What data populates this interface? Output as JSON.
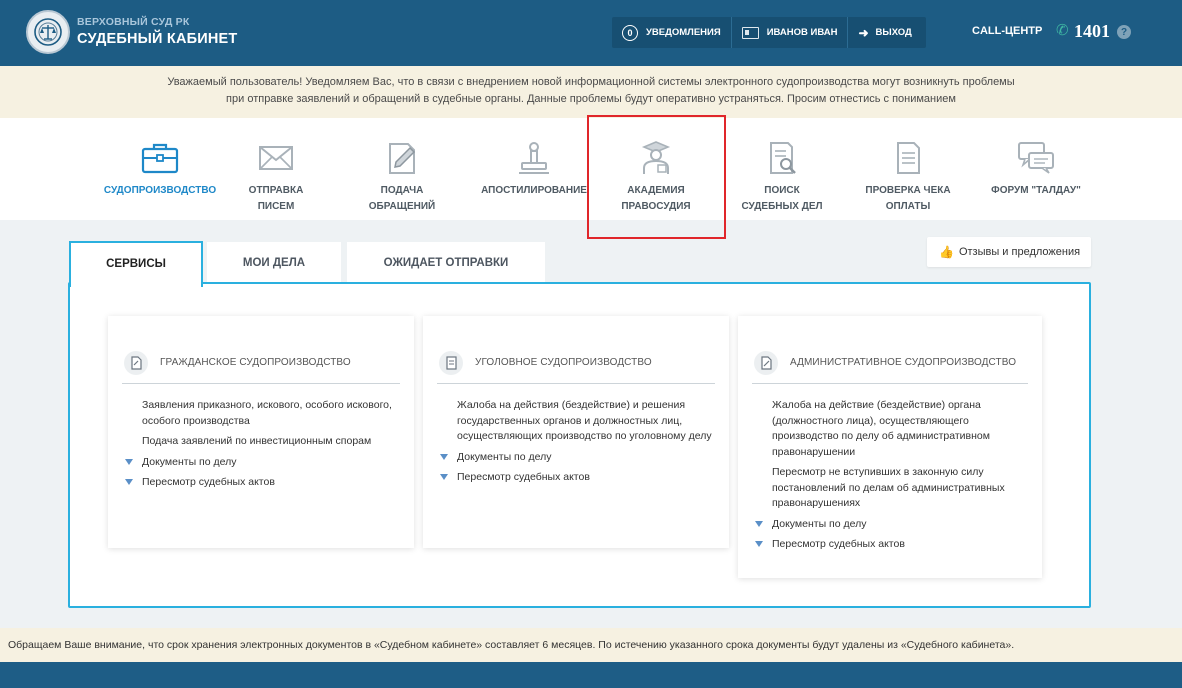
{
  "header": {
    "logo_small": "ВЕРХОВНЫЙ СУД РК",
    "logo_big": "СУДЕБНЫЙ КАБИНЕТ",
    "notifications_count": "0",
    "notifications_label": "УВЕДОМЛЕНИЯ",
    "user_name": "ИВАНОВ ИВАН",
    "logout_label": "ВЫХОД",
    "callcenter_label": "CALL-ЦЕНТР",
    "callcenter_number": "1401",
    "help_glyph": "?"
  },
  "notice": {
    "line1": "Уважаемый пользователь! Уведомляем Вас, что в связи с внедрением новой информационной системы электронного судопроизводства могут возникнуть проблемы",
    "line2": "при отправке заявлений и обращений в судебные органы. Данные проблемы будут оперативно устраняться. Просим отнестись с пониманием"
  },
  "nav": {
    "items": [
      {
        "line1": "СУДОПРОИЗВОДСТВО",
        "line2": "",
        "icon": "briefcase-icon",
        "active": true
      },
      {
        "line1": "ОТПРАВКА",
        "line2": "ПИСЕМ",
        "icon": "envelope-icon"
      },
      {
        "line1": "ПОДАЧА",
        "line2": "ОБРАЩЕНИЙ",
        "icon": "document-pen-icon"
      },
      {
        "line1": "АПОСТИЛИРОВАНИЕ",
        "line2": "",
        "icon": "stamp-icon"
      },
      {
        "line1": "АКАДЕМИЯ",
        "line2": "ПРАВОСУДИЯ",
        "icon": "graduate-icon"
      },
      {
        "line1": "ПОИСК",
        "line2": "СУДЕБНЫХ ДЕЛ",
        "icon": "document-search-icon"
      },
      {
        "line1": "ПРОВЕРКА ЧЕКА",
        "line2": "ОПЛАТЫ",
        "icon": "receipt-icon"
      },
      {
        "line1": "ФОРУМ \"ТАЛДАУ\"",
        "line2": "",
        "icon": "chat-icon"
      }
    ]
  },
  "tabs": [
    "СЕРВИСЫ",
    "МОИ ДЕЛА",
    "ОЖИДАЕТ ОТПРАВКИ"
  ],
  "feedback_label": "Отзывы и предложения",
  "cards": [
    {
      "title": "ГРАЖДАНСКОЕ СУДОПРОИЗВОДСТВО",
      "items": [
        {
          "text": "Заявления приказного, искового, особого искового, особого производства",
          "arrow": false
        },
        {
          "text": "Подача заявлений по инвестиционным спорам",
          "arrow": false
        },
        {
          "text": "Документы по делу",
          "arrow": true
        },
        {
          "text": "Пересмотр судебных актов",
          "arrow": true
        }
      ]
    },
    {
      "title": "УГОЛОВНОЕ СУДОПРОИЗВОДСТВО",
      "items": [
        {
          "text": "Жалоба на действия (бездействие) и решения государственных органов и должностных лиц, осуществляющих производство по уголовному делу",
          "arrow": false
        },
        {
          "text": "Документы по делу",
          "arrow": true
        },
        {
          "text": "Пересмотр судебных актов",
          "arrow": true
        }
      ]
    },
    {
      "title": "АДМИНИСТРАТИВНОЕ СУДОПРОИЗВОДСТВО",
      "items": [
        {
          "text": "Жалоба на действие (бездействие) органа (должностного лица), осуществляющего производство по делу об административном правонарушении",
          "arrow": false
        },
        {
          "text": "Пересмотр не вступивших в законную силу постановлений по делам об административных правонарушениях",
          "arrow": false
        },
        {
          "text": "Документы по делу",
          "arrow": true
        },
        {
          "text": "Пересмотр судебных актов",
          "arrow": true
        }
      ]
    }
  ],
  "footnote": "Обращаем Ваше внимание, что срок хранения электронных документов в «Судебном кабинете» составляет 6 месяцев. По истечению указанного срока документы будут удалены из «Судебного кабинета».",
  "colors": {
    "header_bg": "#1d5c84",
    "accent": "#2ab0df",
    "active_nav": "#1e88c8",
    "highlight": "#e0262a",
    "notice_bg": "#f6f1e1"
  }
}
